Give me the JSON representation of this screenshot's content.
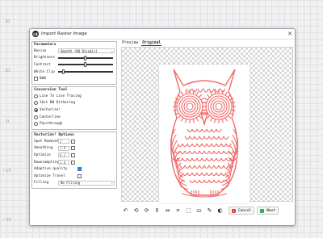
{
  "rulers": [
    "20",
    "10",
    "0",
    "−10",
    "−20"
  ],
  "window": {
    "title": "Import Raster Image",
    "icon": "app-logo-icon",
    "close_glyph": "✕"
  },
  "parameters": {
    "title": "Parameters",
    "resize_label": "Resize",
    "resize_value": "Smooth (HQ Bicubic)",
    "brightness_label": "Brightness",
    "brightness_level": 0.5,
    "contrast_label": "Contrast",
    "contrast_level": 0.5,
    "white_clip_label": "White Clip",
    "white_clip_level": 0.1,
    "bw_label": "B&W",
    "bw_checked": false
  },
  "conversion": {
    "title": "Conversion Tool",
    "options": [
      {
        "label": "Line To Line Tracing",
        "selected": false
      },
      {
        "label": "1bit BW Dithering",
        "selected": false
      },
      {
        "label": "Vectorize!",
        "selected": true
      },
      {
        "label": "Centerline",
        "selected": false
      },
      {
        "label": "Passthrough",
        "selected": false
      }
    ]
  },
  "vectorize": {
    "title": "Vectorize! Options",
    "spot_removal_label": "Spot Removal",
    "spot_removal_value": "2",
    "smoothing_label": "Smoothing",
    "smoothing_value": "1.0",
    "optimize_label": "Optimize",
    "optimize_value": "0.2",
    "downsampling_label": "Downsampling",
    "downsampling_value": "2.0",
    "adaptive_quality_label": "Adaptive quality",
    "adaptive_quality_checked": true,
    "optimize_travel_label": "Optimize Travel",
    "optimize_travel_checked": false,
    "filling_label": "Filling",
    "filling_value": "No Filling"
  },
  "tabs": [
    "Preview",
    "Original"
  ],
  "toolbar": {
    "tools": [
      {
        "name": "rotate-left-icon",
        "glyph": "↶"
      },
      {
        "name": "rotate-ccw-icon",
        "glyph": "⟲"
      },
      {
        "name": "rotate-cw-icon",
        "glyph": "⟳"
      },
      {
        "name": "flip-vertical-icon",
        "glyph": "⇕"
      },
      {
        "name": "flip-horizontal-icon",
        "glyph": "⇔"
      },
      {
        "name": "crop-icon",
        "glyph": "⌗"
      },
      {
        "name": "select-area-icon",
        "glyph": "⬚"
      },
      {
        "name": "fill-bucket-icon",
        "glyph": "⛀"
      },
      {
        "name": "eyedropper-icon",
        "glyph": "✎"
      },
      {
        "name": "invert-icon",
        "glyph": "◐"
      }
    ],
    "cancel_label": "Cancel",
    "next_label": "Next"
  },
  "colors": {
    "trace": "#f06b6b",
    "cancel": "#e23b3b",
    "next": "#2aa84a",
    "accent": "#2b7de9"
  }
}
